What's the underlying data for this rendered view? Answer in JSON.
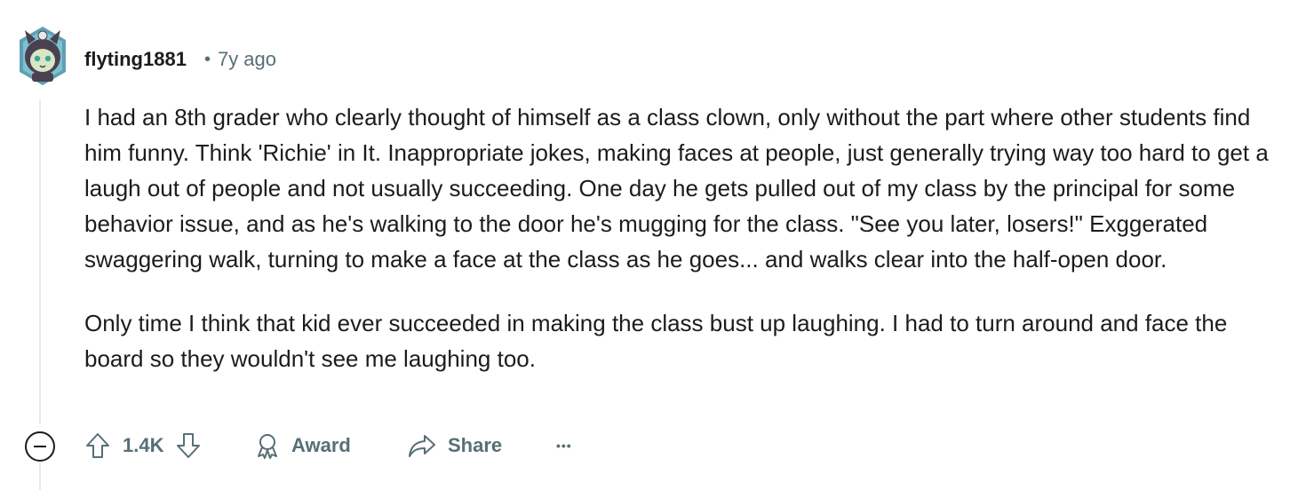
{
  "comment": {
    "author": "flyting1881",
    "separator": "•",
    "age": "7y ago",
    "paragraphs": [
      "I had an 8th grader who clearly thought of himself as a class clown, only without the part where other students find him funny. Think 'Richie' in It. Inappropriate jokes, making faces at people, just generally trying way too hard to get a laugh out of people and not usually succeeding. One day he gets pulled out of my class by the principal for some behavior issue, and as he's walking to the door he's mugging for the class. \"See you later, losers!\" Exggerated swaggering walk, turning to make a face at the class as he goes... and walks clear into the half-open door.",
      "Only time I think that kid ever succeeded in making the class bust up laughing. I had to turn around and face the board so they wouldn't see me laughing too."
    ]
  },
  "actions": {
    "score": "1.4K",
    "award_label": "Award",
    "share_label": "Share",
    "more_label": "•••"
  },
  "icons": {
    "collapse": "minus-circle-icon",
    "upvote": "arrow-up-icon",
    "downvote": "arrow-down-icon",
    "award": "award-ribbon-icon",
    "share": "share-arrow-icon",
    "more": "ellipsis-icon"
  },
  "colors": {
    "text": "#1c1c1c",
    "muted": "#576f76",
    "thread_line": "#e5ebee"
  }
}
